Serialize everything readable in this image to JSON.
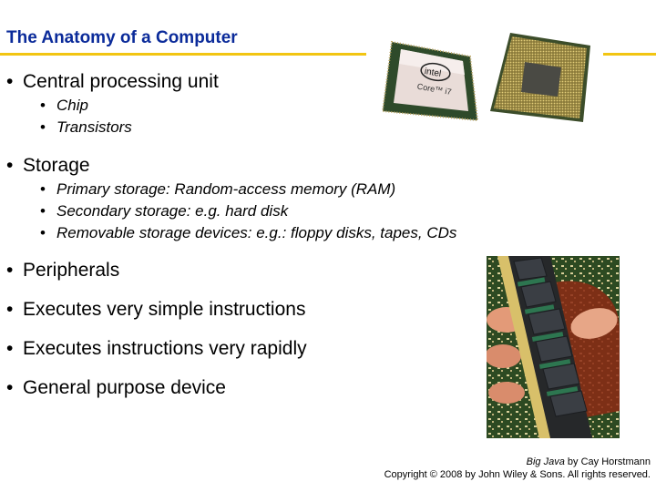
{
  "slide": {
    "title": "The Anatomy of a Computer",
    "accent_color": "#f2c512",
    "title_color": "#0b2b9a",
    "bullets": [
      {
        "text": "Central processing unit",
        "sub": [
          "Chip",
          "Transistors"
        ]
      },
      {
        "text": "Storage",
        "sub": [
          "Primary storage: Random-access memory (RAM)",
          "Secondary storage: e.g. hard disk",
          "Removable storage devices: e.g.: floppy disks, tapes, CDs"
        ]
      },
      {
        "text": "Peripherals",
        "sub": []
      },
      {
        "text": "Executes very simple instructions",
        "sub": []
      },
      {
        "text": "Executes instructions very rapidly",
        "sub": []
      },
      {
        "text": "General purpose device",
        "sub": []
      }
    ],
    "bullet_glyph": "•",
    "images": {
      "cpu_front": {
        "brand": "intel",
        "model": "Core™ i7"
      },
      "cpu_back": "CPU pin side",
      "ram": "RAM module held in hand"
    },
    "footer": {
      "book_title": "Big Java",
      "author_line": " by Cay Horstmann",
      "copyright": "Copyright © 2008 by John Wiley & Sons.  All rights reserved."
    }
  }
}
